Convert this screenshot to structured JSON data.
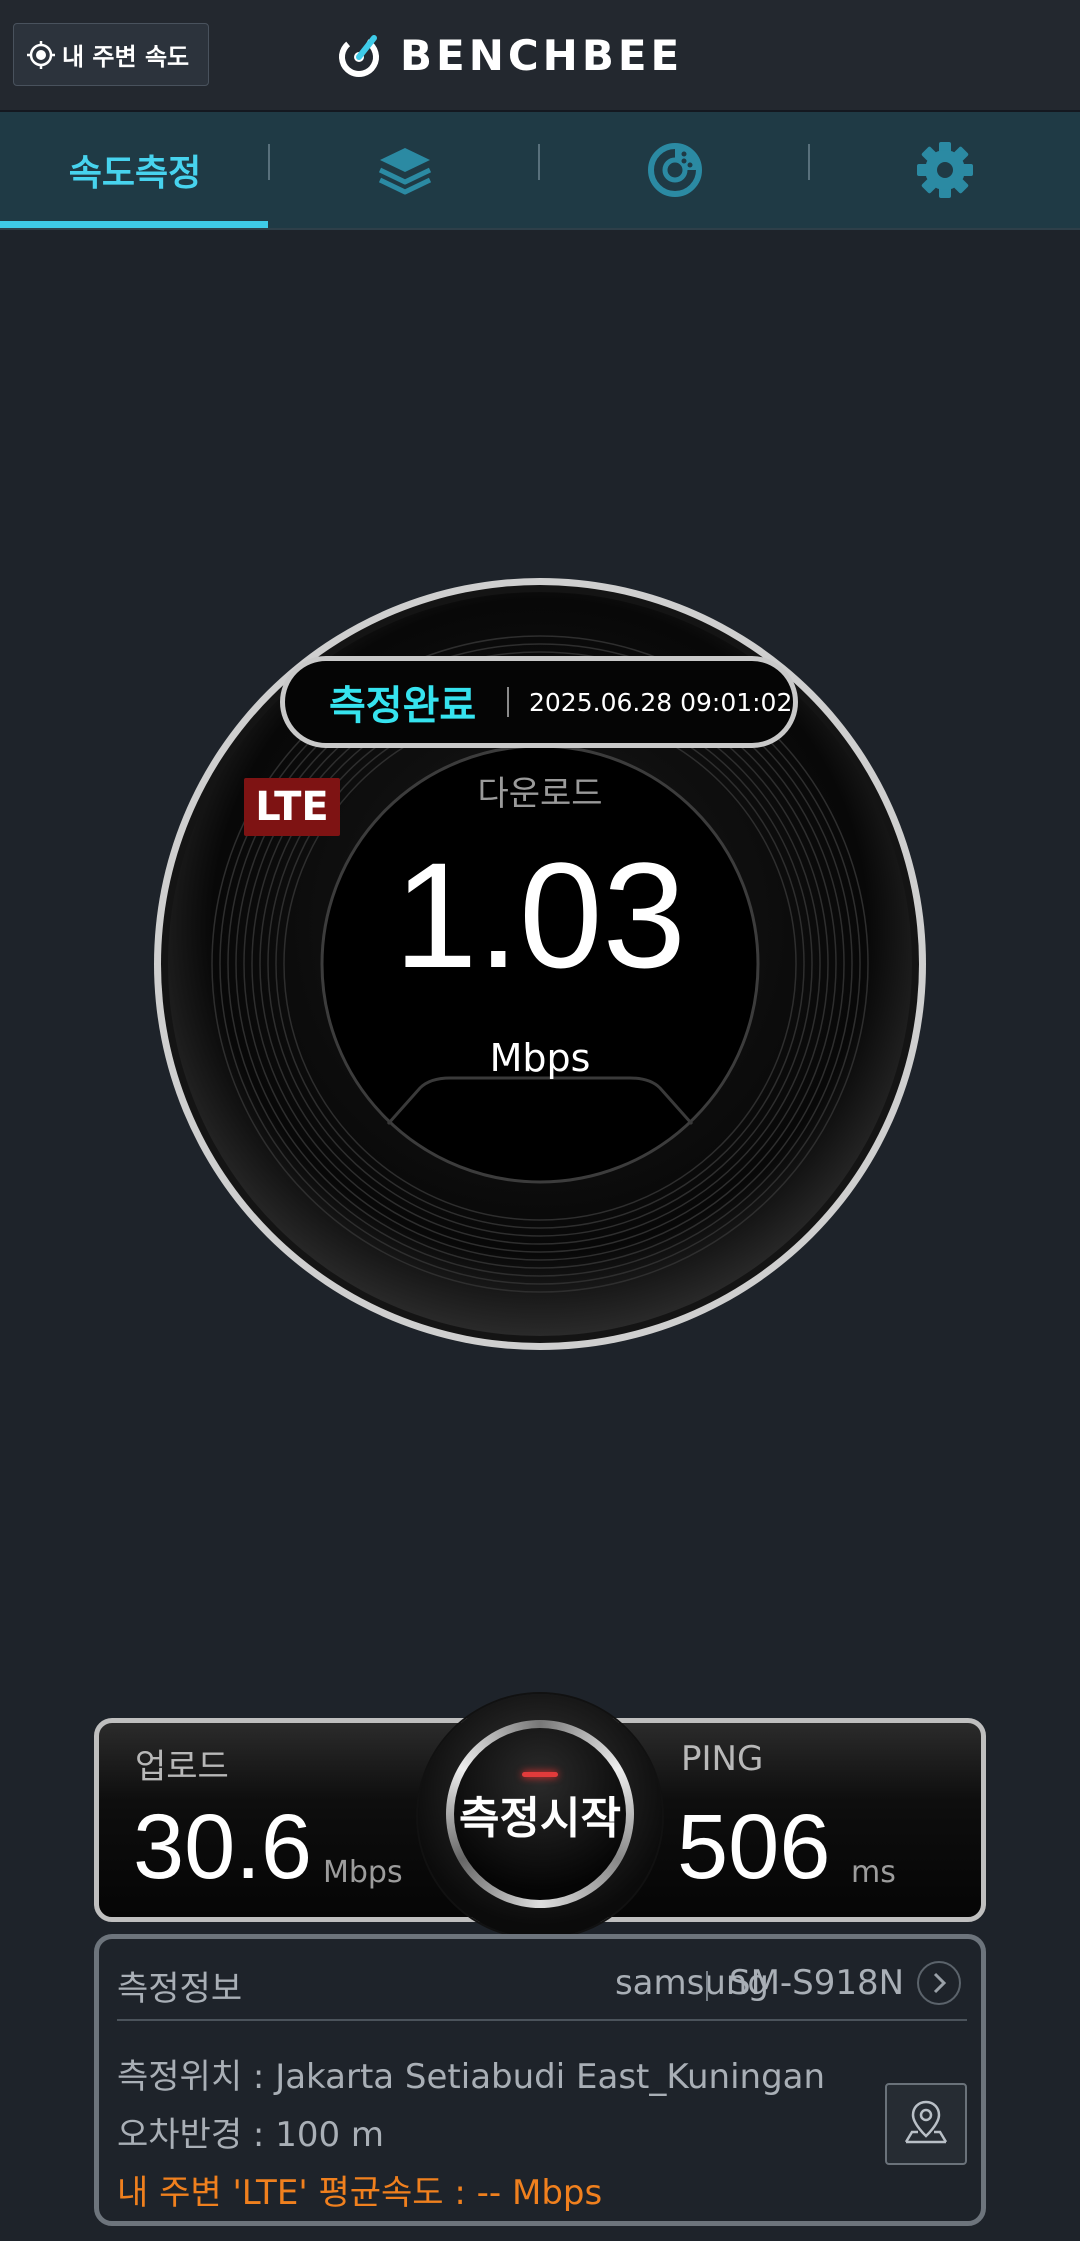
{
  "header": {
    "nearby_label": "내 주변 속도",
    "logo_text": "BENCHBEE"
  },
  "tabs": [
    {
      "label": "속도측정",
      "icon": "speed-test",
      "active": true
    },
    {
      "label": "",
      "icon": "layers-icon"
    },
    {
      "label": "",
      "icon": "stats-icon"
    },
    {
      "label": "",
      "icon": "gear-icon"
    }
  ],
  "gauge": {
    "status": "측정완료",
    "timestamp": "2025.06.28 09:01:02",
    "network": "LTE",
    "download_label": "다운로드",
    "download_value": "1.03",
    "download_unit": "Mbps"
  },
  "results": {
    "upload_label": "업로드",
    "upload_value": "30.6",
    "upload_unit": "Mbps",
    "start_label": "측정시작",
    "ping_label": "PING",
    "ping_value": "506",
    "ping_unit": "ms"
  },
  "info": {
    "title": "측정정보",
    "maker": "samsung",
    "model": "SM-S918N",
    "location": "측정위치 : Jakarta Setiabudi East_Kuningan",
    "radius": "오차반경 : 100 m",
    "avg_speed": "내 주변 'LTE' 평균속도 :  -- Mbps"
  },
  "colors": {
    "background": "#1e232a",
    "tabbar": "#1f3a45",
    "accent": "#47d3ee",
    "status_text": "#36e3ef",
    "lte_badge": "#7e1313",
    "warning_text": "#f0801e"
  }
}
